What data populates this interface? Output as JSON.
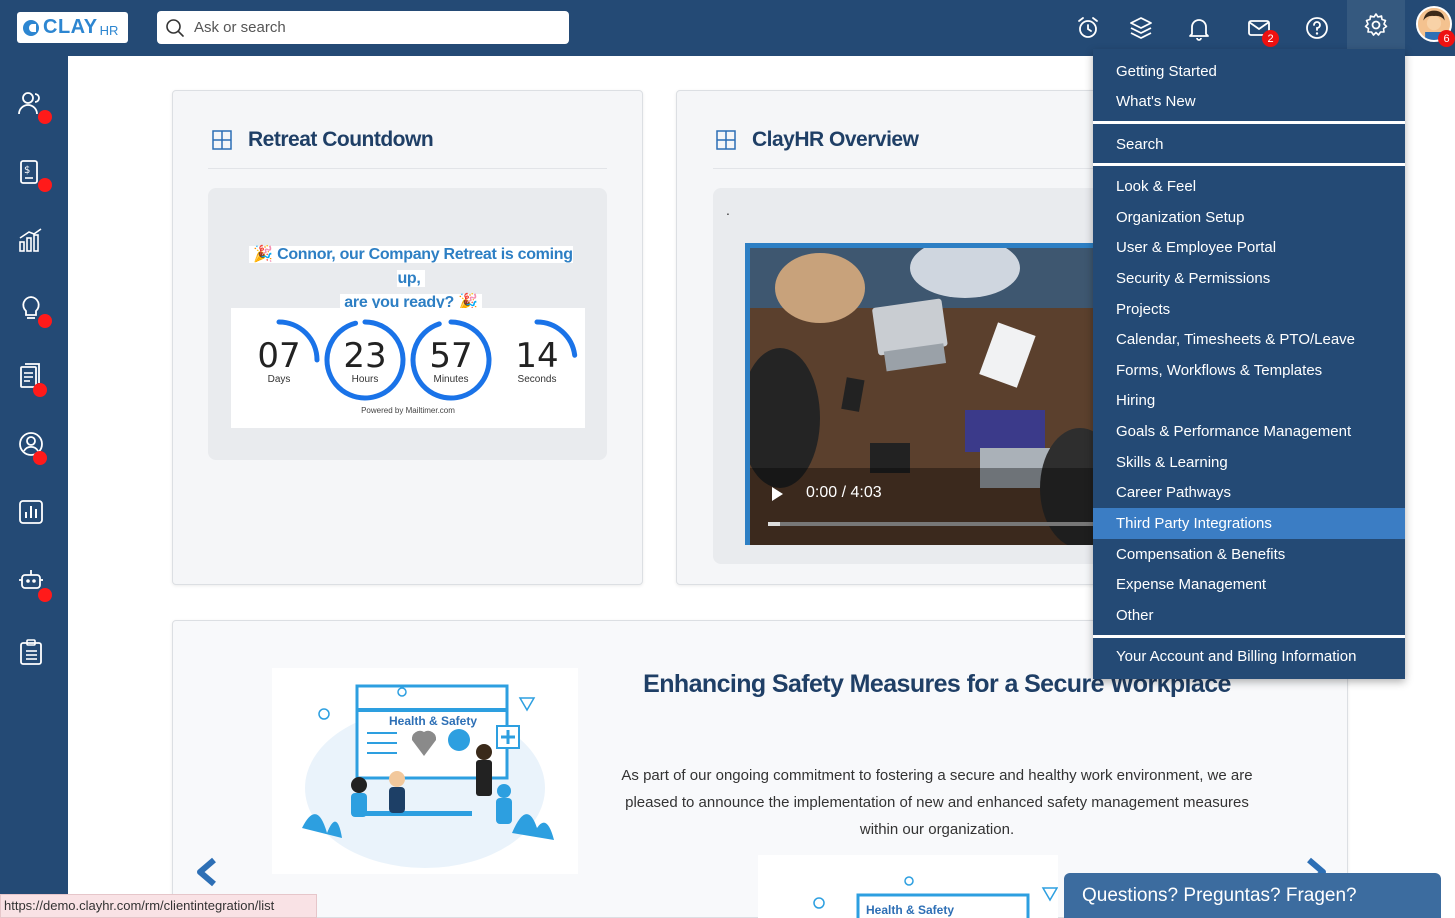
{
  "brand": {
    "logo_text": "CLAY",
    "logo_sub": "HR"
  },
  "search": {
    "placeholder": "Ask or search"
  },
  "header": {
    "mail_badge": "2",
    "avatar_badge": "6"
  },
  "cards": {
    "countdown": {
      "title": "Retreat Countdown",
      "message_line1": "🎉 Connor, our Company Retreat is coming up,",
      "message_line2": "are you ready? 🎉",
      "units": [
        {
          "value": "07",
          "label": "Days",
          "fraction": 0.25
        },
        {
          "value": "23",
          "label": "Hours",
          "fraction": 0.96
        },
        {
          "value": "57",
          "label": "Minutes",
          "fraction": 0.95
        },
        {
          "value": "14",
          "label": "Seconds",
          "fraction": 0.23
        }
      ],
      "powered": "Powered by Mailtimer.com"
    },
    "overview": {
      "title": "ClayHR Overview",
      "dot": ".",
      "video_time": "0:00 / 4:03"
    }
  },
  "article": {
    "title": "Enhancing Safety Measures for a Secure Workplace",
    "body": "As part of our ongoing commitment to fostering a secure and healthy work environment, we are pleased to announce the implementation of new and enhanced safety management measures within our organization.",
    "illustration_label": "Health & Safety"
  },
  "menu": {
    "items": [
      "Getting Started",
      "What's New",
      "Search",
      "Look & Feel",
      "Organization Setup",
      "User & Employee Portal",
      "Security & Permissions",
      "Projects",
      "Calendar, Timesheets & PTO/Leave",
      "Forms, Workflows & Templates",
      "Hiring",
      "Goals & Performance Management",
      "Skills & Learning",
      "Career Pathways",
      "Third Party Integrations",
      "Compensation & Benefits",
      "Expense Management",
      "Other",
      "Your Account and Billing Information"
    ],
    "active": "Third Party Integrations"
  },
  "status_url": "https://demo.clayhr.com/rm/clientintegration/list",
  "chat": {
    "label": "Questions? Preguntas? Fragen?"
  }
}
